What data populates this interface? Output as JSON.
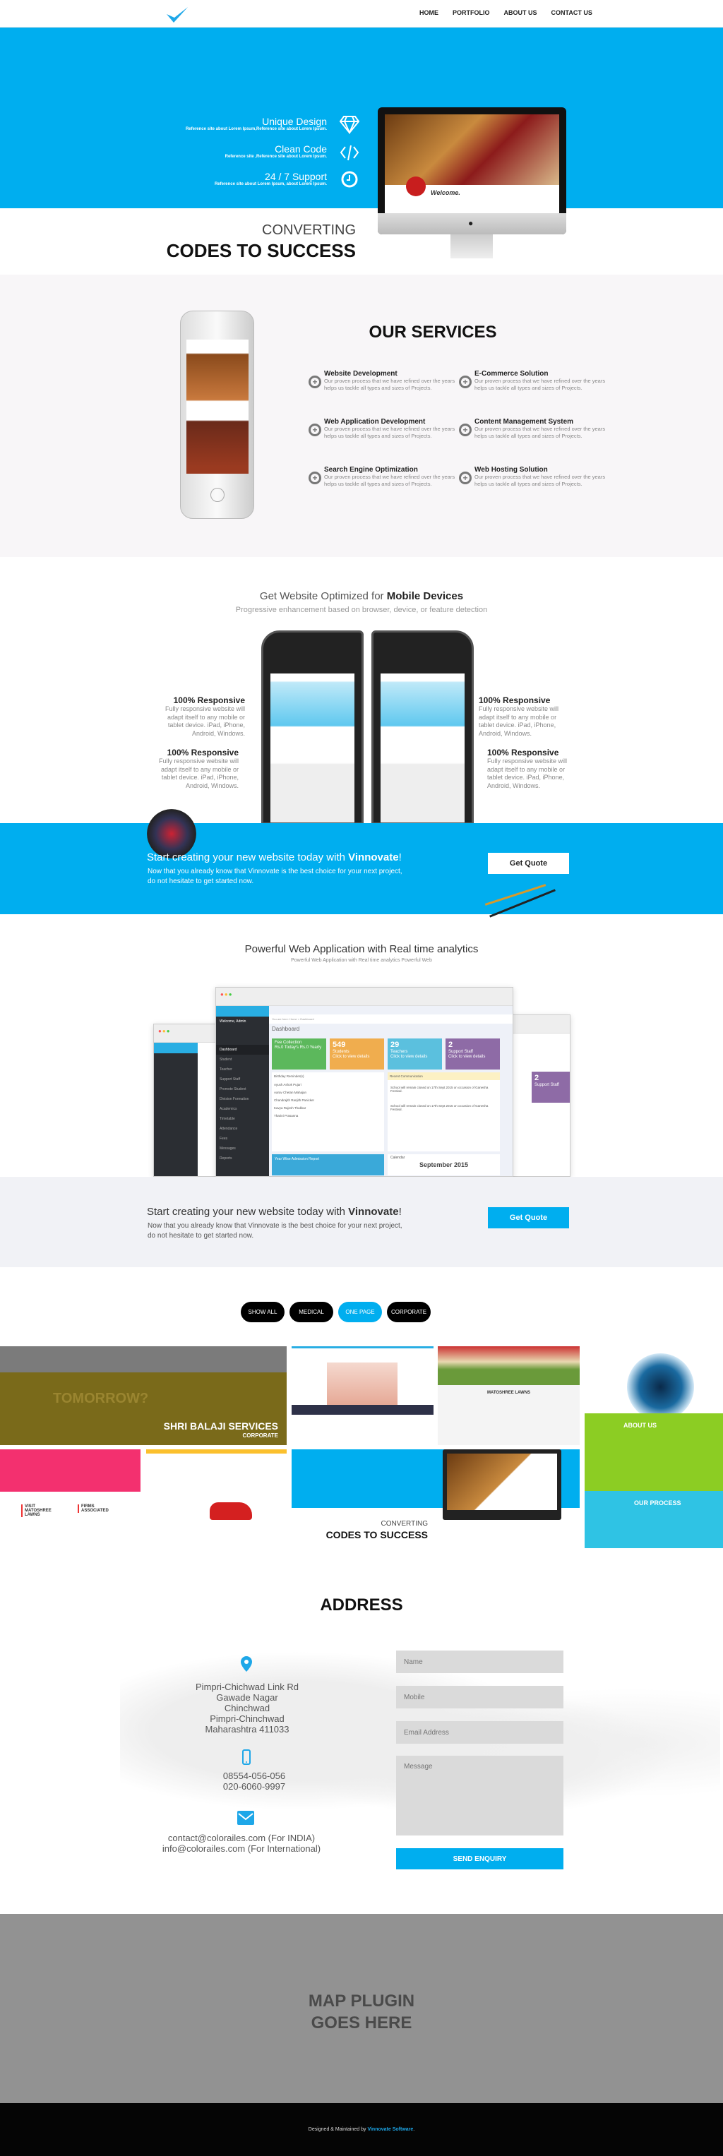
{
  "colors": {
    "accent": "#00aeef",
    "footer": "#050505",
    "map": "#929292"
  },
  "nav": {
    "logo_icon": "checkmark-icon",
    "links": [
      "HOME",
      "PORTFOLIO",
      "ABOUT US",
      "CONTACT US"
    ]
  },
  "hero": {
    "features": [
      {
        "title": "Unique Design",
        "desc": "Reference site about Lorem Ipsum,Reference site about Lorem Ipsum.",
        "icon": "diamond-icon"
      },
      {
        "title": "Clean Code",
        "desc": "Reference site ,Reference site about Lorem Ipsum.",
        "icon": "code-icon"
      },
      {
        "title": "24 / 7 Support",
        "desc": "Reference site about Lorem Ipsum, about Lorem Ipsum.",
        "icon": "clock-icon"
      }
    ],
    "converting": "CONVERTING",
    "codes": "CODES TO SUCCESS",
    "screen_welcome": "Welcome."
  },
  "services": {
    "title": "OUR SERVICES",
    "items": [
      {
        "title": "Website Development",
        "desc": "Our proven process that we have refined over the years helps us tackle all types and sizes of Projects."
      },
      {
        "title": "E-Commerce Solution",
        "desc": "Our proven process that we have refined over the years helps us tackle all types and sizes of Projects."
      },
      {
        "title": "Web Application Development",
        "desc": "Our proven process that we have refined over the years helps us tackle all types and sizes of Projects."
      },
      {
        "title": "Content Management System",
        "desc": "Our proven process that we have refined over the years helps us tackle all types and sizes of Projects."
      },
      {
        "title": "Search Engine Optimization",
        "desc": "Our proven process that we have refined over the years helps us tackle all types and sizes of Projects."
      },
      {
        "title": "Web Hosting Solution",
        "desc": "Our proven process that we have refined over the years helps us tackle all types and sizes of Projects."
      }
    ]
  },
  "mobile": {
    "title_pre": "Get Website Optimized for ",
    "title_bold": "Mobile Devices",
    "subtitle": "Progressive enhancement based on browser, device, or feature detection",
    "features": [
      {
        "title": "100% Responsive",
        "desc": "Fully responsive website will adapt itself to any mobile or tablet device. iPad, iPhone, Android, Windows."
      },
      {
        "title": "100% Responsive",
        "desc": "Fully responsive website will adapt itself to any mobile or tablet device. iPad, iPhone, Android, Windows."
      },
      {
        "title": "100% Responsive",
        "desc": "Fully responsive website will adapt itself to any mobile or tablet device. iPad, iPhone, Android, Windows."
      },
      {
        "title": "100% Responsive",
        "desc": "Fully responsive website will adapt itself to any mobile or tablet device. iPad, iPhone, Android, Windows."
      }
    ]
  },
  "cta": {
    "title_pre": "Start creating your new website today with ",
    "brand": "Vinnovate",
    "bang": "!",
    "line1": "Now that you already know that Vinnovate is the best choice for your next project,",
    "line2": "do not hesitate to get started now.",
    "button": "Get Quote"
  },
  "analytics": {
    "title": "Powerful Web Application with Real time analytics",
    "subtitle": "Powerful Web Application with Real time analytics Powerful Web",
    "dashboard": {
      "welcome": "Welcome, Admin",
      "heading": "Dashboard",
      "breadcrumb": "You are here:  Home > Dashboard",
      "sidebar": [
        "Dashboard",
        "Student",
        "Teacher",
        "Support Staff",
        "Promote Student",
        "Division Formation",
        "Academics",
        "Timetable",
        "Attendance",
        "Fees",
        "Messages",
        "Reports"
      ],
      "tiles": [
        {
          "value": "",
          "label": "Fee Collection",
          "sub": "Rs.0 Today's   Rs.0 Yearly",
          "color": "#5cb85c"
        },
        {
          "value": "549",
          "label": "Students",
          "sub": "Click to view details",
          "color": "#f0ad4e"
        },
        {
          "value": "29",
          "label": "Teachers",
          "sub": "Click to view details",
          "color": "#5bc0de"
        },
        {
          "value": "2",
          "label": "Support Staff",
          "sub": "Click to view details",
          "color": "#8e6ba6"
        }
      ],
      "birthday_title": "Birthday Reminder(s)",
      "birthdays": [
        "Ayush Ashok Pujari",
        "Aarav Chetan Mahajan",
        "Chandrajith Ranjith Panicker",
        "Kavya Rajesh Thakkar",
        "Tharini Prasanna"
      ],
      "comm_title": "Recent Communication",
      "comm_text": "School will remain closed on 17th Sept 2015 on occasion of Ganesha Festival.",
      "report_title": "Year Wise Admission Report",
      "calendar_title": "Calendar",
      "calendar_month": "September 2015"
    }
  },
  "portfolio": {
    "filters": [
      {
        "label": "SHOW ALL",
        "active": false
      },
      {
        "label": "MEDICAL",
        "active": false
      },
      {
        "label": "ONE PAGE",
        "active": true
      },
      {
        "label": "CORPORATE",
        "active": false
      }
    ],
    "balaji_q": "TOMORROW?",
    "balaji_name": "SHRI BALAJI SERVICES",
    "balaji_sub": "CORPORATE",
    "lawns": "MATOSHREE LAWNS",
    "about": "ABOUT US",
    "process": "OUR PROCESS",
    "visit": "VISIT MATOSHREE LAWNS",
    "firms": "FIRMS ASSOCIATED"
  },
  "address": {
    "title": "ADDRESS",
    "lines": [
      "Pimpri-Chichwad Link Rd",
      "Gawade Nagar",
      "Chinchwad",
      "Pimpri-Chinchwad",
      "Maharashtra 411033"
    ],
    "phones": [
      "08554-056-056",
      "020-6060-9997"
    ],
    "emails": [
      "contact@colorailes.com  (For INDIA)",
      "info@colorailes.com  (For International)"
    ],
    "form": {
      "name": "Name",
      "mobile": "Mobile",
      "email": "Email Address",
      "message": "Message",
      "submit": "SEND ENQUIRY"
    }
  },
  "map": {
    "line1": "MAP PLUGIN",
    "line2": "GOES HERE"
  },
  "footer": {
    "pre": "Designed & Maintained by ",
    "link": "Vinnovate Software",
    "post": "."
  }
}
